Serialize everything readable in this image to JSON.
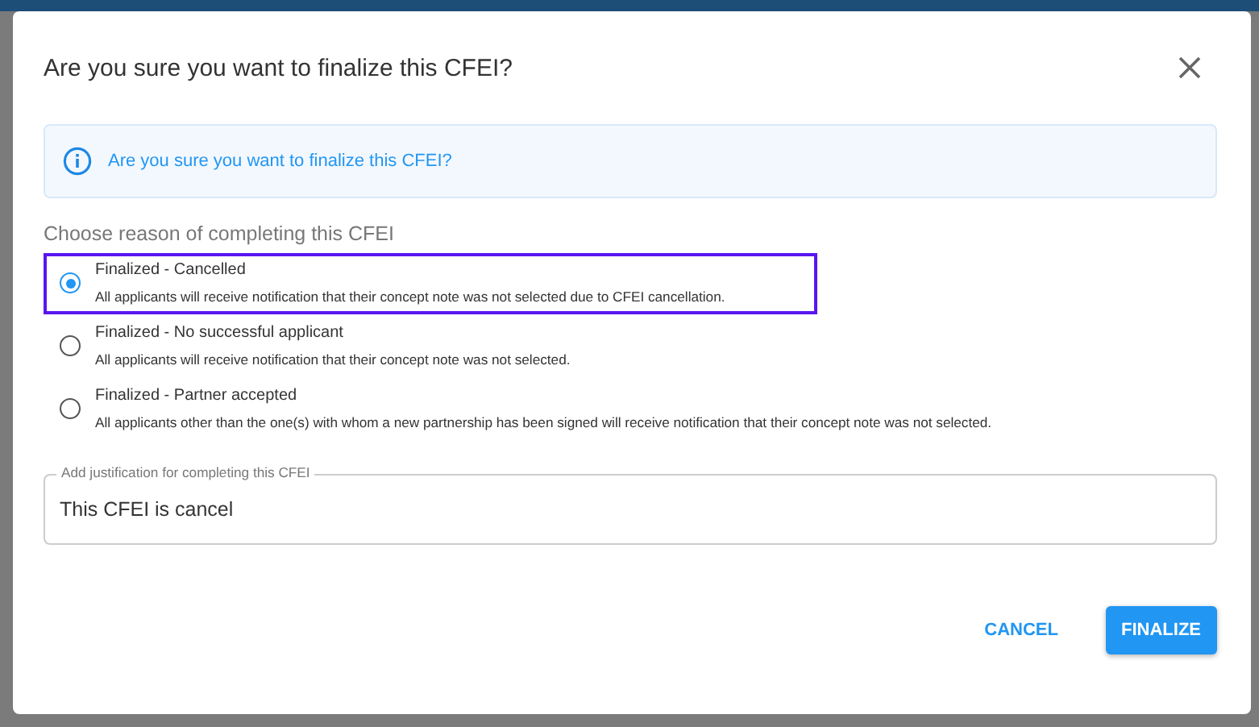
{
  "dialog": {
    "title": "Are you sure you want to finalize this CFEI?",
    "info": "Are you sure you want to finalize this CFEI?",
    "reason_label": "Choose reason of completing this CFEI",
    "options": [
      {
        "label": "Finalized - Cancelled",
        "description": "All applicants will receive notification that their concept note was not selected due to CFEI cancellation.",
        "selected": true,
        "highlighted": true
      },
      {
        "label": "Finalized - No successful applicant",
        "description": "All applicants will receive notification that their concept note was not selected.",
        "selected": false,
        "highlighted": false
      },
      {
        "label": "Finalized - Partner accepted",
        "description": "All applicants other than the one(s) with whom a new partnership has been signed will receive notification that their concept note was not selected.",
        "selected": false,
        "highlighted": false
      }
    ],
    "justification": {
      "label": "Add justification for completing this CFEI",
      "value": "This CFEI is cancel"
    },
    "buttons": [
      {
        "label": "CANCEL",
        "kind": "text"
      },
      {
        "label": "FINALIZE",
        "kind": "primary"
      }
    ]
  }
}
